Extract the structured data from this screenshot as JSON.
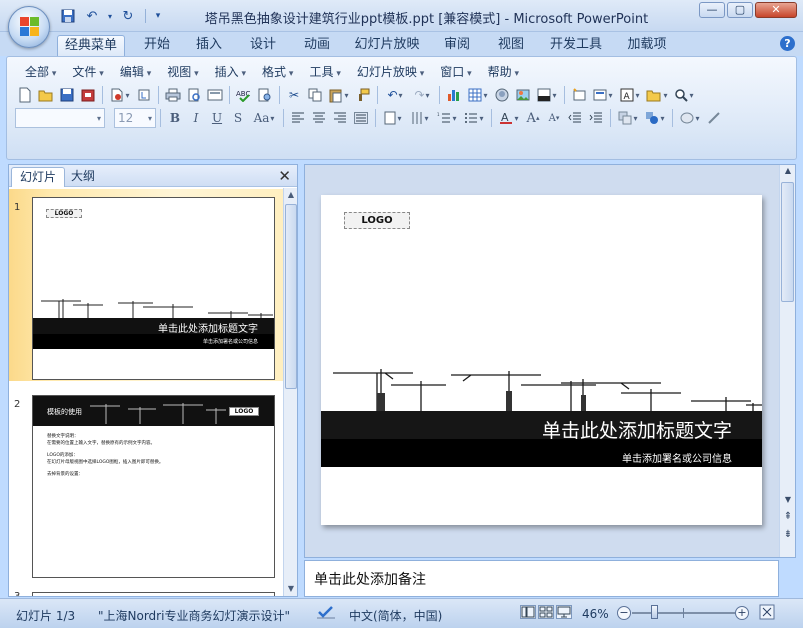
{
  "window": {
    "title": "塔吊黑色抽象设计建筑行业ppt模板.ppt [兼容模式] - Microsoft PowerPoint",
    "controls": [
      "—",
      "▢",
      "✕"
    ]
  },
  "ribbon_tabs": [
    "经典菜单",
    "开始",
    "插入",
    "设计",
    "动画",
    "幻灯片放映",
    "审阅",
    "视图",
    "开发工具",
    "加载项"
  ],
  "help_symbol": "?",
  "classic_menu": [
    "全部",
    "文件",
    "编辑",
    "视图",
    "插入",
    "格式",
    "工具",
    "幻灯片放映",
    "窗口",
    "帮助"
  ],
  "format_bar": {
    "font_name": "",
    "font_size": "12"
  },
  "left_pane": {
    "tabs": [
      "幻灯片",
      "大纲"
    ],
    "close_symbol": "✕",
    "slide_numbers": [
      "1",
      "2",
      "3"
    ],
    "thumb1": {
      "logo": "LOGO",
      "title": "单击此处添加标题文字",
      "subtitle": "单击添加署名或公司信息"
    },
    "thumb2": {
      "header": "模板的使用",
      "logo": "LOGO",
      "line1": "替换文字说明：",
      "line2": "在需要的位置上输入文字，替换原有的示例文字内容。",
      "line3": "LOGO的添加：",
      "line4": "在幻灯片母版视图中选择LOGO图框，插入图片即可替换。",
      "line5": "去掉背景的设置："
    }
  },
  "slide": {
    "logo": "LOGO",
    "title": "单击此处添加标题文字",
    "subtitle": "单击添加署名或公司信息"
  },
  "notes": {
    "placeholder": "单击此处添加备注"
  },
  "status": {
    "slide_info": "幻灯片 1/3",
    "theme": "\"上海Nordri专业商务幻灯演示设计\"",
    "language": "中文(简体，中国)",
    "zoom": "46%"
  },
  "colors": {
    "ribbon_bg": "#dce8f7",
    "selected_thumb": "#ffe9ad",
    "slide_band": "#111111"
  }
}
